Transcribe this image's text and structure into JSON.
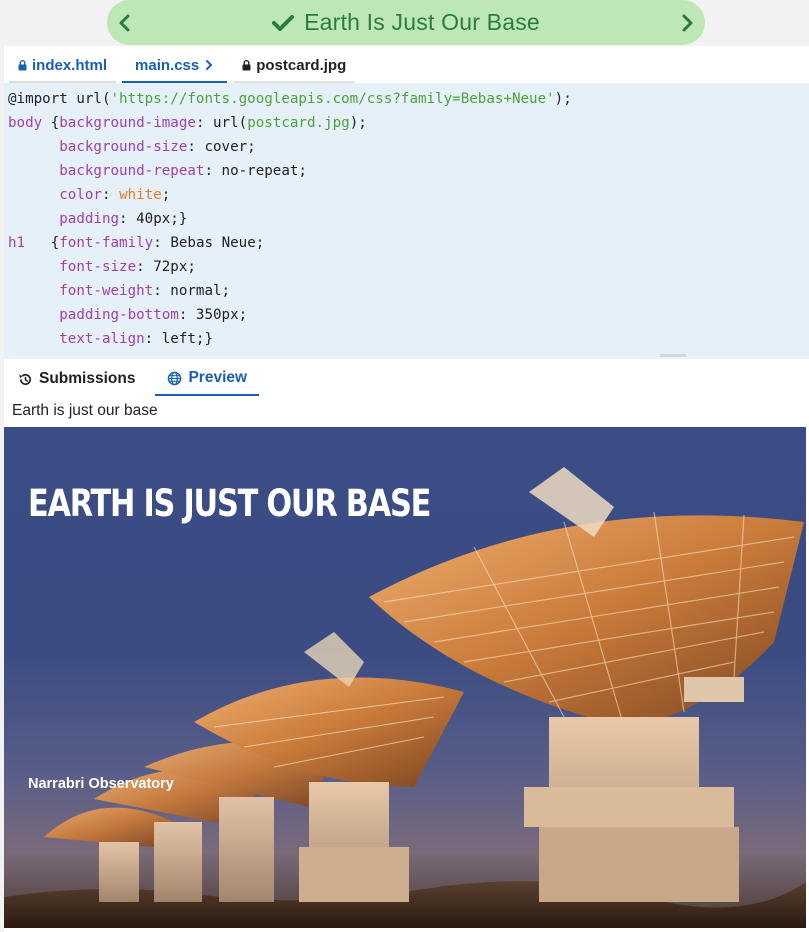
{
  "header": {
    "title": "Earth Is Just Our Base",
    "prev_icon": "chevron-left-icon",
    "next_icon": "chevron-right-icon",
    "status_icon": "check-icon",
    "accent": "#2a7d3b",
    "pill_color": "#bde8b6"
  },
  "file_tabs": [
    {
      "label": "index.html",
      "icon": "lock-icon"
    },
    {
      "label": "main.css",
      "icon": "chevron-right-icon"
    },
    {
      "label": "postcard.jpg",
      "icon": "lock-icon"
    }
  ],
  "code_lines": [
    [
      {
        "t": "@import url("
      },
      {
        "t": "'https://fonts.googleapis.com/css?family=Bebas+Neue'",
        "c": "s"
      },
      {
        "t": ");"
      }
    ],
    [
      {
        "t": "body",
        "c": "k"
      },
      {
        "t": " {"
      },
      {
        "t": "background-image",
        "c": "k"
      },
      {
        "t": ": url("
      },
      {
        "t": "postcard.jpg",
        "c": "s"
      },
      {
        "t": ");"
      }
    ],
    [
      {
        "t": "      "
      },
      {
        "t": "background-size",
        "c": "k"
      },
      {
        "t": ": cover;"
      }
    ],
    [
      {
        "t": "      "
      },
      {
        "t": "background-repeat",
        "c": "k"
      },
      {
        "t": ": no-repeat;"
      }
    ],
    [
      {
        "t": "      "
      },
      {
        "t": "color",
        "c": "k"
      },
      {
        "t": ": "
      },
      {
        "t": "white",
        "c": "o"
      },
      {
        "t": ";"
      }
    ],
    [
      {
        "t": "      "
      },
      {
        "t": "padding",
        "c": "k"
      },
      {
        "t": ": 40px;}"
      }
    ],
    [
      {
        "t": "h1",
        "c": "k"
      },
      {
        "t": "   {"
      },
      {
        "t": "font-family",
        "c": "k"
      },
      {
        "t": ": Bebas Neue;"
      }
    ],
    [
      {
        "t": "      "
      },
      {
        "t": "font-size",
        "c": "k"
      },
      {
        "t": ": 72px;"
      }
    ],
    [
      {
        "t": "      "
      },
      {
        "t": "font-weight",
        "c": "k"
      },
      {
        "t": ": normal;"
      }
    ],
    [
      {
        "t": "      "
      },
      {
        "t": "padding-bottom",
        "c": "k"
      },
      {
        "t": ": 350px;"
      }
    ],
    [
      {
        "t": "      "
      },
      {
        "t": "text-align",
        "c": "k"
      },
      {
        "t": ": left;}"
      }
    ]
  ],
  "output_tabs": [
    {
      "label": "Submissions",
      "icon": "history-icon"
    },
    {
      "label": "Preview",
      "icon": "globe-icon"
    }
  ],
  "preview": {
    "page_title": "Earth is just our base",
    "heading": "EARTH IS JUST OUR BASE",
    "caption": "Narrabri Observatory"
  },
  "colors": {
    "link_blue": "#1b5fb3",
    "editor_bg": "#e6f0f9",
    "keyword": "#a040b0",
    "string": "#4aa43a",
    "value": "#e67e22"
  }
}
